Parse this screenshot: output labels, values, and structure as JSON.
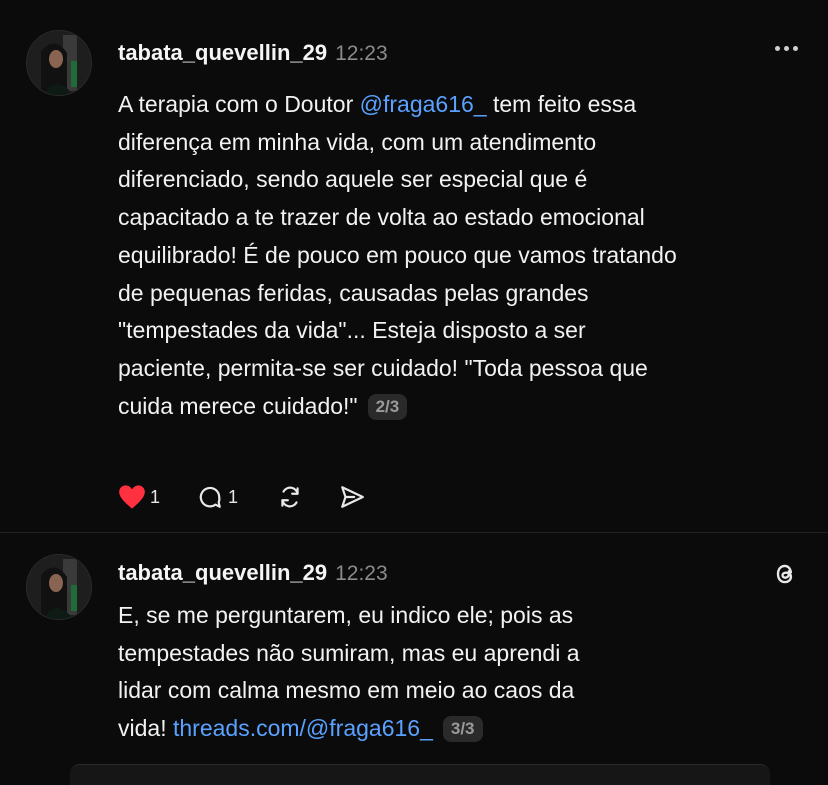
{
  "posts": [
    {
      "username": "tabata_quevellin_29",
      "time": "12:23",
      "text_pre": "A terapia com o Doutor ",
      "mention": "@fraga616_",
      "text_post": " tem feito essa diferença em minha vida, com um atendimento diferenciado, sendo aquele ser especial que é capacitado a te trazer de volta ao estado emocional equilibrado! É de pouco em pouco que vamos tratando de pequenas feridas, causadas pelas grandes \"tempestades da vida\"... Esteja disposto a ser paciente, permita-se ser cuidado! \"Toda pessoa que cuida merece cuidado!\"",
      "thread_index": "2/3",
      "likes": "1",
      "replies": "1",
      "icons": [
        "heart-icon",
        "comment-icon",
        "repost-icon",
        "share-icon",
        "more-icon"
      ]
    },
    {
      "username": "tabata_quevellin_29",
      "time": "12:23",
      "text_pre": "E, se me perguntarem, eu indico ele; pois as tempestades não sumiram, mas eu aprendi a lidar com calma mesmo em meio ao caos da vida! ",
      "link": "threads.com/@fraga616_",
      "thread_index": "3/3",
      "icons": [
        "threads-logo-icon"
      ]
    }
  ],
  "colors": {
    "background": "#0b0b0b",
    "text": "#f2f2f2",
    "muted": "#8b8b8b",
    "link": "#5aa2ff",
    "like": "#ff3040"
  }
}
